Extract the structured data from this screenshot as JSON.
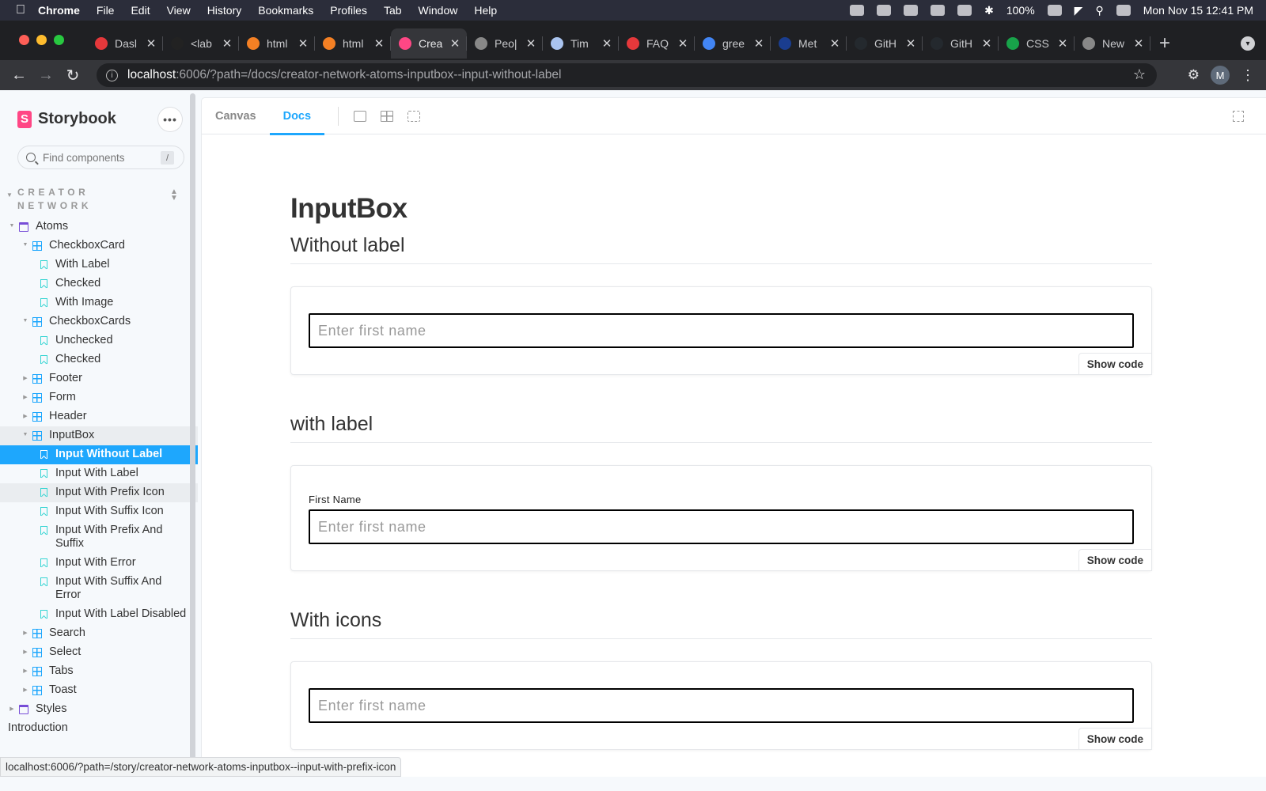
{
  "menubar": {
    "items": [
      "Chrome",
      "File",
      "Edit",
      "View",
      "History",
      "Bookmarks",
      "Profiles",
      "Tab",
      "Window",
      "Help"
    ],
    "battery": "100%",
    "datetime": "Mon Nov 15  12:41 PM"
  },
  "browser": {
    "tabs": [
      {
        "label": "Dasl",
        "fav_color": "#e5383b"
      },
      {
        "label": "<lab",
        "fav_color": "#222222"
      },
      {
        "label": "html",
        "fav_color": "#f48024"
      },
      {
        "label": "html",
        "fav_color": "#f48024"
      },
      {
        "label": "Crea",
        "fav_color": "#ff4785"
      },
      {
        "label": "Peo|",
        "fav_color": "#888888"
      },
      {
        "label": "Tim",
        "fav_color": "#aac4f0"
      },
      {
        "label": "FAQ",
        "fav_color": "#e5383b"
      },
      {
        "label": "gree",
        "fav_color": "#4285f4"
      },
      {
        "label": "Met",
        "fav_color": "#1a3d8f"
      },
      {
        "label": "GitH",
        "fav_color": "#24292e"
      },
      {
        "label": "GitH",
        "fav_color": "#24292e"
      },
      {
        "label": "CSS",
        "fav_color": "#18a34a"
      },
      {
        "label": "New",
        "fav_color": "#888888"
      }
    ],
    "url_host": "localhost",
    "url_rest": ":6006/?path=/docs/creator-network-atoms-inputbox--input-without-label",
    "profile_initial": "M"
  },
  "sidebar": {
    "brand": "Storybook",
    "search_placeholder": "Find components",
    "search_shortcut": "/",
    "group_line1": "CREATOR",
    "group_line2": "NETWORK",
    "tree": [
      {
        "label": "Atoms",
        "level": 0,
        "type": "folder",
        "caret": "down"
      },
      {
        "label": "CheckboxCard",
        "level": 1,
        "type": "component",
        "caret": "down"
      },
      {
        "label": "With Label",
        "level": 2,
        "type": "story"
      },
      {
        "label": "Checked",
        "level": 2,
        "type": "story"
      },
      {
        "label": "With Image",
        "level": 2,
        "type": "story"
      },
      {
        "label": "CheckboxCards",
        "level": 1,
        "type": "component",
        "caret": "down"
      },
      {
        "label": "Unchecked",
        "level": 2,
        "type": "story"
      },
      {
        "label": "Checked",
        "level": 2,
        "type": "story"
      },
      {
        "label": "Footer",
        "level": 1,
        "type": "component",
        "caret": "right"
      },
      {
        "label": "Form",
        "level": 1,
        "type": "component",
        "caret": "right"
      },
      {
        "label": "Header",
        "level": 1,
        "type": "component",
        "caret": "right"
      },
      {
        "label": "InputBox",
        "level": 1,
        "type": "component",
        "caret": "down",
        "state": "hover"
      },
      {
        "label": "Input Without Label",
        "level": 2,
        "type": "story",
        "state": "selected"
      },
      {
        "label": "Input With Label",
        "level": 2,
        "type": "story"
      },
      {
        "label": "Input With Prefix Icon",
        "level": 2,
        "type": "story",
        "state": "hover"
      },
      {
        "label": "Input With Suffix Icon",
        "level": 2,
        "type": "story"
      },
      {
        "label": "Input With Prefix And Suffix",
        "level": 2,
        "type": "story",
        "tall": true
      },
      {
        "label": "Input With Error",
        "level": 2,
        "type": "story"
      },
      {
        "label": "Input With Suffix And Error",
        "level": 2,
        "type": "story",
        "tall": true
      },
      {
        "label": "Input With Label Disabled",
        "level": 2,
        "type": "story"
      },
      {
        "label": "Search",
        "level": 1,
        "type": "component",
        "caret": "right"
      },
      {
        "label": "Select",
        "level": 1,
        "type": "component",
        "caret": "right"
      },
      {
        "label": "Tabs",
        "level": 1,
        "type": "component",
        "caret": "right"
      },
      {
        "label": "Toast",
        "level": 1,
        "type": "component",
        "caret": "right"
      },
      {
        "label": "Styles",
        "level": 0,
        "type": "folder",
        "caret": "right"
      },
      {
        "label": "Introduction",
        "level": 0,
        "type": "doc"
      }
    ]
  },
  "main": {
    "tabs": {
      "canvas": "Canvas",
      "docs": "Docs"
    },
    "title": "InputBox",
    "sections": [
      {
        "heading": "Without label",
        "label": "",
        "placeholder": "Enter first name",
        "show_code": "Show code"
      },
      {
        "heading": "with label",
        "label": "First Name",
        "placeholder": "Enter first name",
        "show_code": "Show code"
      },
      {
        "heading": "With icons",
        "label": "",
        "placeholder": "Enter first name",
        "show_code": "Show code"
      }
    ]
  },
  "status_url": "localhost:6006/?path=/story/creator-network-atoms-inputbox--input-with-prefix-icon",
  "colors": {
    "accent": "#1ea7fd",
    "brand": "#ff4785"
  }
}
